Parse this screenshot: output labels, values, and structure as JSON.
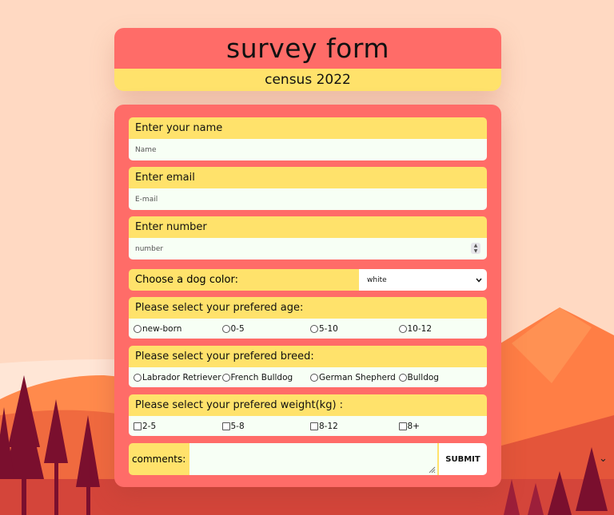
{
  "header": {
    "title": "survey form",
    "subtitle": "census 2022"
  },
  "form": {
    "name": {
      "label": "Enter your name",
      "placeholder": "Name"
    },
    "email": {
      "label": "Enter email",
      "placeholder": "E-mail"
    },
    "number": {
      "label": "Enter number",
      "placeholder": "number"
    },
    "dog_color": {
      "label": "Choose a dog color:",
      "selected": "white"
    },
    "age": {
      "label": "Please select your prefered age:",
      "options": [
        "new-born",
        "0-5",
        "5-10",
        "10-12"
      ]
    },
    "breed": {
      "label": "Please select your prefered breed:",
      "options": [
        "Labrador Retriever",
        "French Bulldog",
        "German Shepherd",
        "Bulldog"
      ]
    },
    "weight": {
      "label": "Please select your prefered weight(kg) :",
      "options": [
        "2-5",
        "5-8",
        "8-12",
        "8+"
      ]
    },
    "comments": {
      "label": "comments:",
      "submit_label": "SUBMIT"
    }
  },
  "icons": {
    "select_arrow": "chevron-down-icon",
    "resize": "resize-handle-icon",
    "spinner": "number-spinner-icon"
  },
  "colors": {
    "accent_red": "#ff6c68",
    "accent_yellow": "#ffe26b",
    "input_bg": "#f7fff5",
    "page_bg": "#ffd9c2"
  }
}
